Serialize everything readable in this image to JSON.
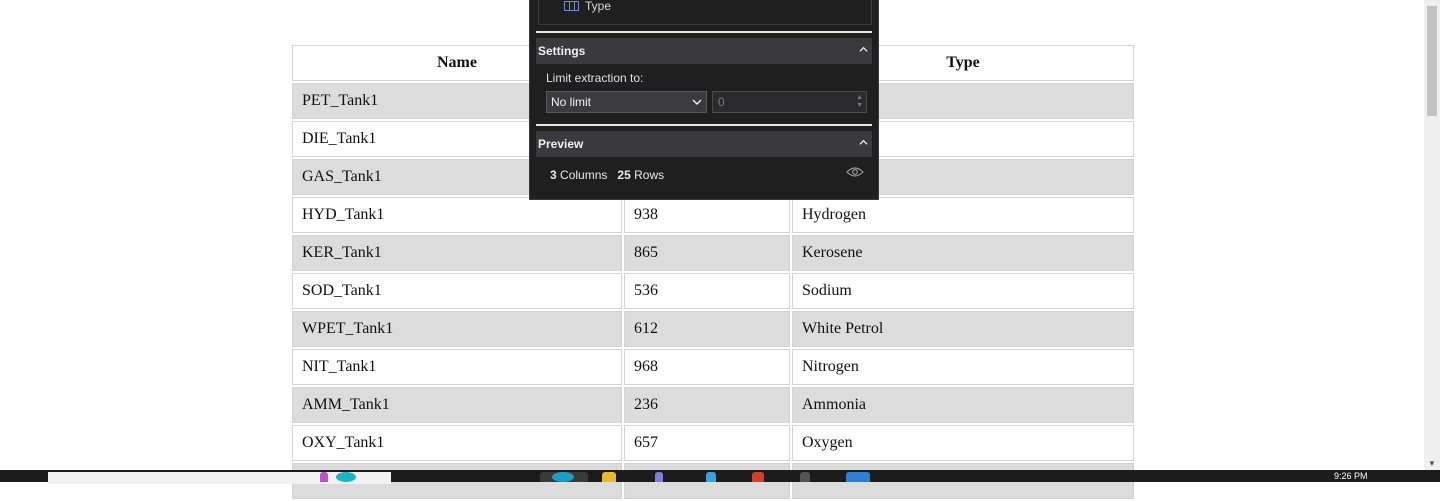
{
  "table": {
    "headers": [
      "Name",
      "",
      "Type"
    ],
    "rows": [
      {
        "name": "PET_Tank1",
        "value": "",
        "type": ""
      },
      {
        "name": "DIE_Tank1",
        "value": "",
        "type": ""
      },
      {
        "name": "GAS_Tank1",
        "value": "",
        "type": ""
      },
      {
        "name": "HYD_Tank1",
        "value": "938",
        "type": "Hydrogen"
      },
      {
        "name": "KER_Tank1",
        "value": "865",
        "type": "Kerosene"
      },
      {
        "name": "SOD_Tank1",
        "value": "536",
        "type": "Sodium"
      },
      {
        "name": "WPET_Tank1",
        "value": "612",
        "type": "White Petrol"
      },
      {
        "name": "NIT_Tank1",
        "value": "968",
        "type": "Nitrogen"
      },
      {
        "name": "AMM_Tank1",
        "value": "236",
        "type": "Ammonia"
      },
      {
        "name": "OXY_Tank1",
        "value": "657",
        "type": "Oxygen"
      },
      {
        "name": "",
        "value": "",
        "type": ""
      }
    ]
  },
  "panel": {
    "column_item": "Type",
    "settings": {
      "title": "Settings",
      "limit_label": "Limit extraction to:",
      "limit_select": "No limit",
      "limit_value": "0"
    },
    "preview": {
      "title": "Preview",
      "columns_count": "3",
      "columns_label": "Columns",
      "rows_count": "25",
      "rows_label": "Rows"
    }
  },
  "taskbar": {
    "time": "9:26 PM"
  },
  "colors": {
    "panel_bg": "#1f1f1f",
    "section_header": "#3a3a3e",
    "row_shade": "#dcdcdc"
  }
}
